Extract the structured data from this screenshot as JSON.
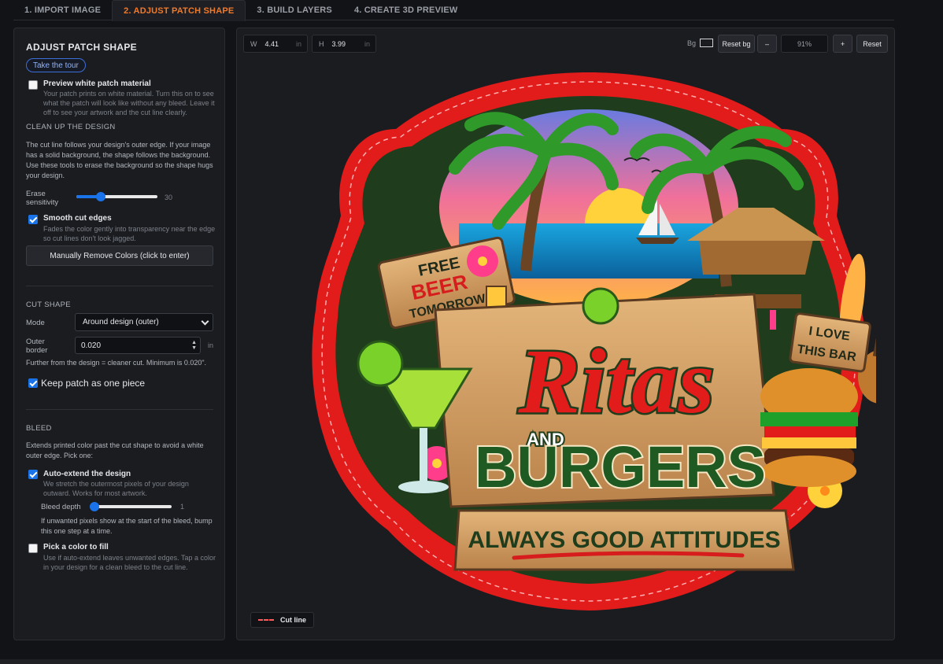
{
  "tabs": [
    {
      "label": "1. IMPORT IMAGE"
    },
    {
      "label": "2. ADJUST PATCH SHAPE"
    },
    {
      "label": "3. BUILD LAYERS"
    },
    {
      "label": "4. CREATE 3D PREVIEW"
    }
  ],
  "panel": {
    "title": "ADJUST PATCH SHAPE",
    "tour_label": "Take the tour",
    "preview_white": {
      "checked": false,
      "label": "Preview white patch material",
      "hint_lines": [
        "Your patch prints on white material. Turn this on to see",
        "what the patch will look like without any bleed. Leave it",
        "off to see your artwork and the cut line clearly."
      ]
    },
    "cleanup": {
      "heading": "CLEAN UP THE DESIGN",
      "desc_lines": [
        "The cut line follows your design's outer edge. If your image",
        "has a solid background, the shape follows the background.",
        "Use these tools to erase the background so the shape hugs",
        "your design."
      ],
      "erase_label_1": "Erase",
      "erase_label_2": "sensitivity",
      "erase_value": "30",
      "erase_fraction": 0.3,
      "smooth": {
        "checked": true,
        "label": "Smooth cut edges",
        "hint_lines": [
          "Fades the color gently into transparency near the edge",
          "so cut lines don't look jagged."
        ]
      },
      "manual_button": "Manually Remove Colors (click to enter)"
    },
    "cut_shape": {
      "heading": "CUT SHAPE",
      "mode_label": "Mode",
      "mode_value": "Around design (outer)",
      "border_label_1": "Outer",
      "border_label_2": "border",
      "border_value": "0.020",
      "border_unit": "in",
      "border_hint": "Further from the design = cleaner cut. Minimum is 0.020\".",
      "one_piece": {
        "checked": true,
        "label": "Keep patch as one piece"
      }
    },
    "bleed": {
      "heading": "BLEED",
      "desc_lines": [
        "Extends printed color past the cut shape to avoid a white",
        "outer edge. Pick one:"
      ],
      "auto_extend": {
        "checked": true,
        "label": "Auto-extend the design",
        "hint_lines": [
          "We stretch the outermost pixels of your design",
          "outward. Works for most artwork."
        ]
      },
      "depth_label": "Bleed depth",
      "depth_value": "1",
      "depth_fraction": 0.02,
      "depth_hint_lines": [
        "If unwanted pixels show at the start of the bleed, bump",
        "this one step at a time."
      ],
      "pick_color": {
        "checked": false,
        "label": "Pick a color to fill",
        "hint_lines": [
          "Use if auto-extend leaves unwanted edges. Tap a color",
          "in your design for a clean bleed to the cut line."
        ]
      }
    }
  },
  "canvas": {
    "width_key": "W",
    "width_value": "4.41",
    "width_unit": "in",
    "height_key": "H",
    "height_value": "3.99",
    "height_unit": "in",
    "bg_label": "Bg",
    "reset_bg_label": "Reset bg",
    "zoom_out_label": "–",
    "zoom_value": "91%",
    "zoom_in_label": "+",
    "reset_label": "Reset",
    "legend_label": "Cut line",
    "colors": {
      "patch_red": "#e21b1b",
      "cut_line": "#ff5b5b",
      "accent": "#f07a2a",
      "primary": "#1a73e8"
    }
  },
  "artwork": {
    "sign_left": [
      "FREE",
      "BEER",
      "TOMORROW"
    ],
    "sign_right": [
      "I LOVE",
      "THIS BAR"
    ],
    "title_main": "Ritas",
    "title_and": "AND",
    "title_burgers": "BURGERS",
    "banner": "ALWAYS GOOD ATTITUDES"
  }
}
